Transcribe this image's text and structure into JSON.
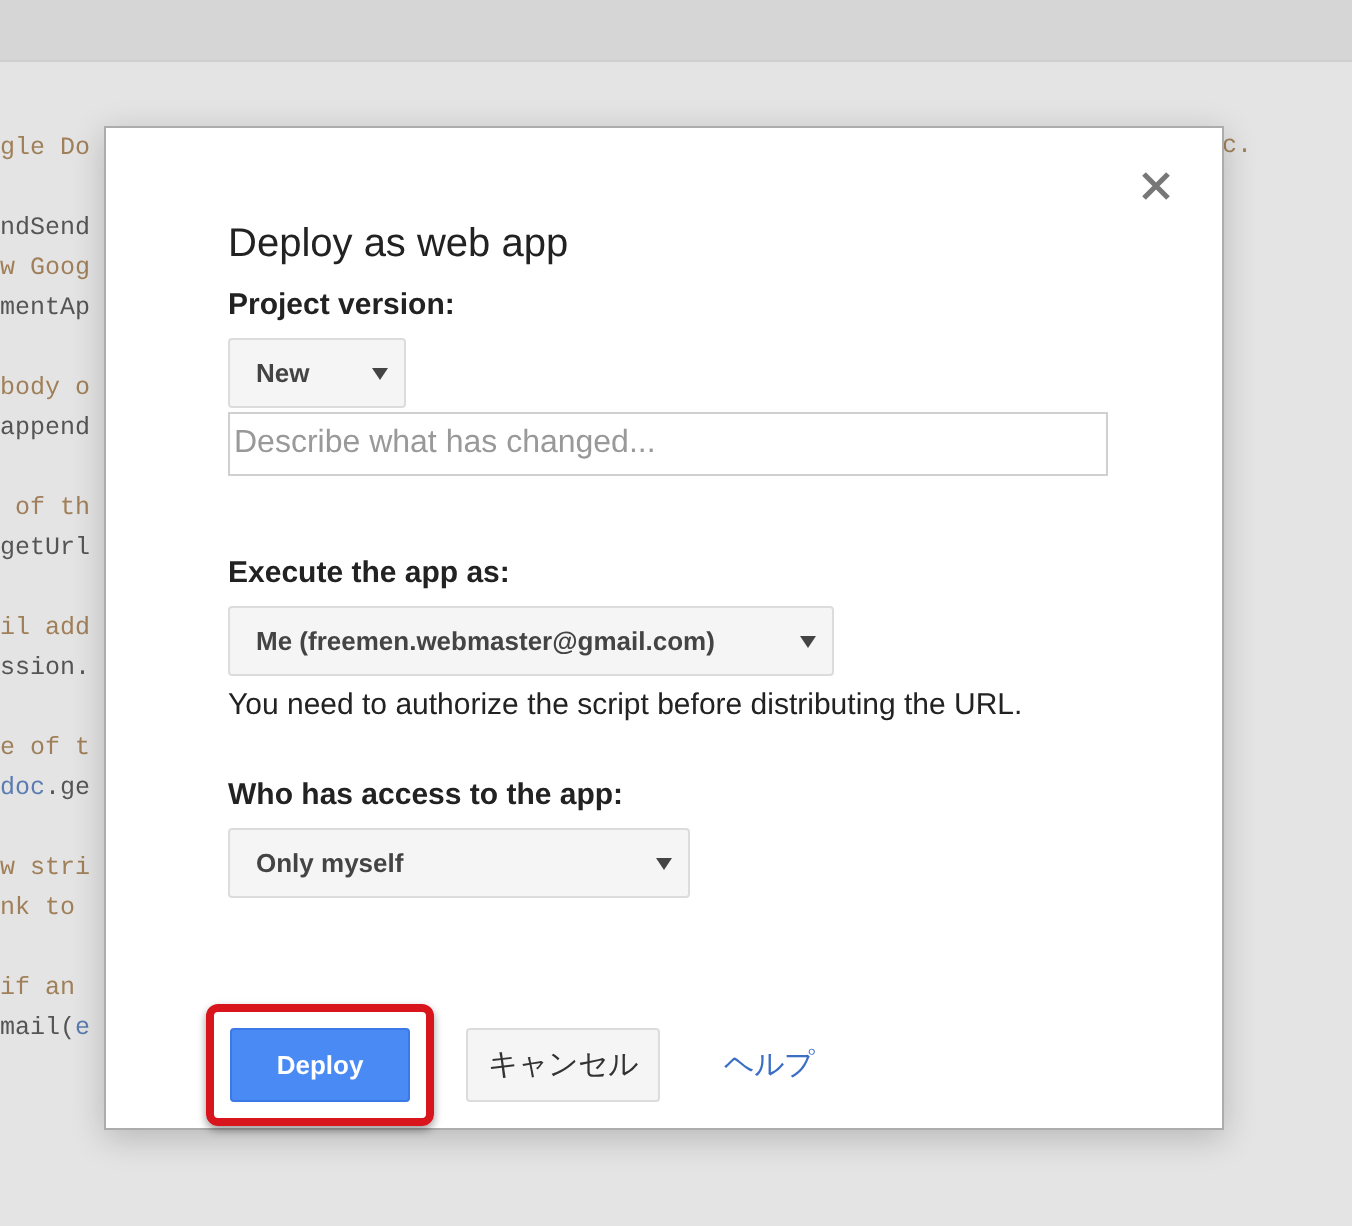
{
  "editor": {
    "lines": [
      {
        "kind": "text",
        "segments": [
          {
            "text": "gle Do",
            "kind": "comment"
          }
        ]
      },
      {
        "kind": "blank"
      },
      {
        "kind": "text",
        "segments": [
          {
            "text": "ndSend",
            "kind": "code"
          }
        ]
      },
      {
        "kind": "text",
        "segments": [
          {
            "text": "w Goog",
            "kind": "comment"
          }
        ]
      },
      {
        "kind": "text",
        "segments": [
          {
            "text": "mentAp",
            "kind": "code"
          }
        ]
      },
      {
        "kind": "blank"
      },
      {
        "kind": "text",
        "segments": [
          {
            "text": "body o",
            "kind": "comment"
          }
        ]
      },
      {
        "kind": "text",
        "segments": [
          {
            "text": "append",
            "kind": "code"
          }
        ]
      },
      {
        "kind": "blank"
      },
      {
        "kind": "text",
        "segments": [
          {
            "text": " of th",
            "kind": "comment"
          }
        ]
      },
      {
        "kind": "text",
        "segments": [
          {
            "text": "getUrl",
            "kind": "code"
          }
        ]
      },
      {
        "kind": "blank"
      },
      {
        "kind": "text",
        "segments": [
          {
            "text": "il add",
            "kind": "comment"
          }
        ]
      },
      {
        "kind": "text",
        "segments": [
          {
            "text": "ssion.",
            "kind": "code"
          }
        ]
      },
      {
        "kind": "blank"
      },
      {
        "kind": "text",
        "segments": [
          {
            "text": "e of t",
            "kind": "comment"
          }
        ]
      },
      {
        "kind": "text",
        "segments": [
          {
            "text": "doc",
            "kind": "variable"
          },
          {
            "text": ".ge",
            "kind": "code"
          }
        ]
      },
      {
        "kind": "blank"
      },
      {
        "kind": "text",
        "segments": [
          {
            "text": "w stri",
            "kind": "comment"
          }
        ]
      },
      {
        "kind": "text",
        "segments": [
          {
            "text": "nk to",
            "kind": "comment"
          }
        ]
      },
      {
        "kind": "blank"
      },
      {
        "kind": "text",
        "segments": [
          {
            "text": "if an",
            "kind": "comment"
          }
        ]
      },
      {
        "kind": "text",
        "segments": [
          {
            "text": "mail(",
            "kind": "code"
          },
          {
            "text": "e",
            "kind": "variable"
          }
        ]
      }
    ],
    "right_fragment": "c."
  },
  "dialog": {
    "title": "Deploy as web app",
    "sections": [
      {
        "kind": "version",
        "label": "Project version:",
        "select": "New",
        "placeholder": "Describe what has changed..."
      },
      {
        "kind": "execute",
        "label": "Execute the app as:",
        "select": "Me (freemen.webmaster@gmail.com)",
        "note": "You need to authorize the script before distributing the URL."
      },
      {
        "kind": "access",
        "label": "Who has access to the app:",
        "select": "Only myself"
      }
    ],
    "buttons": [
      {
        "label": "Deploy",
        "kind": "primary",
        "highlighted": true
      },
      {
        "label": "キャンセル",
        "kind": "secondary",
        "highlighted": false
      },
      {
        "label": "ヘルプ",
        "kind": "link",
        "highlighted": false
      }
    ]
  }
}
